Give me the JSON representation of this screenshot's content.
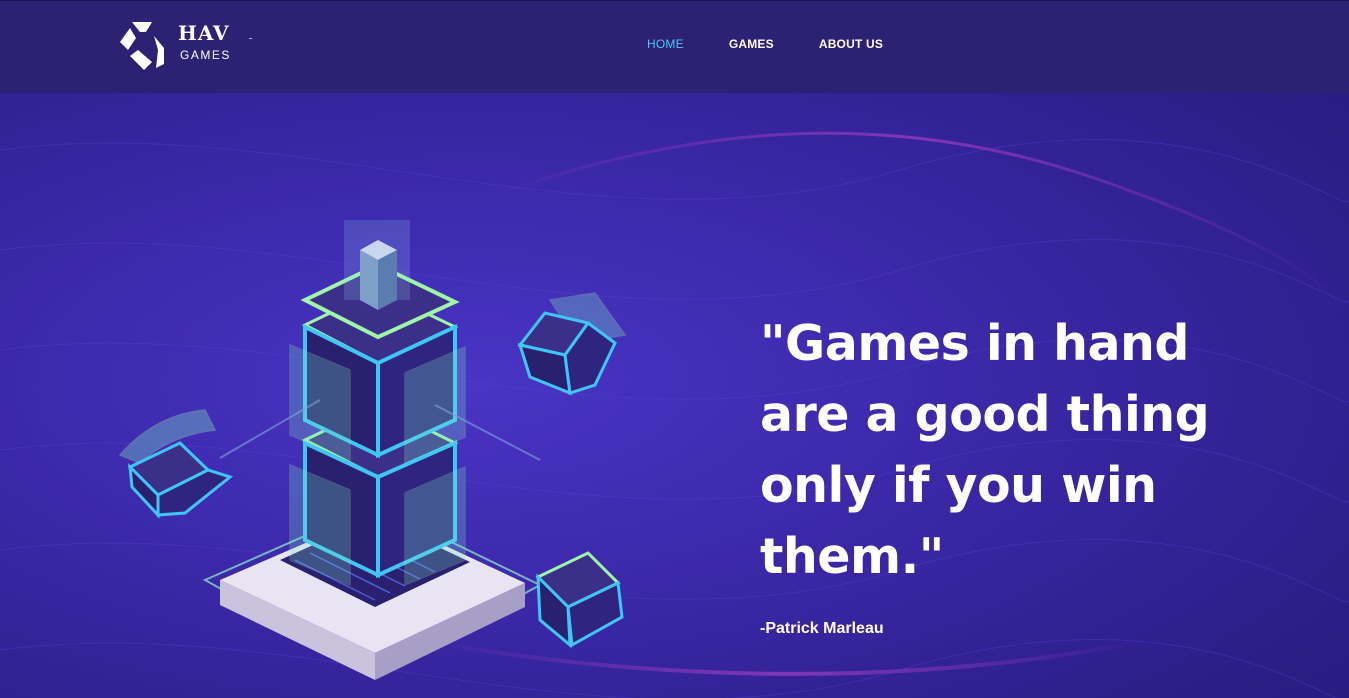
{
  "brand": {
    "name": "HAV",
    "subtitle": "GAMES"
  },
  "nav": {
    "items": [
      "HOME",
      "GAMES",
      "ABOUT US"
    ],
    "active": "HOME"
  },
  "hero": {
    "quote": "\"Games in hand are a good thing only if you win them.\"",
    "author": "-Patrick Marleau"
  },
  "colors": {
    "header_bg": "#2c2173",
    "page_bg": "#3b28a8",
    "nav_active": "#4fc6f7",
    "text": "#ffffff"
  },
  "icons": [
    "logo-mark-icon",
    "isometric-tower-illustration"
  ]
}
